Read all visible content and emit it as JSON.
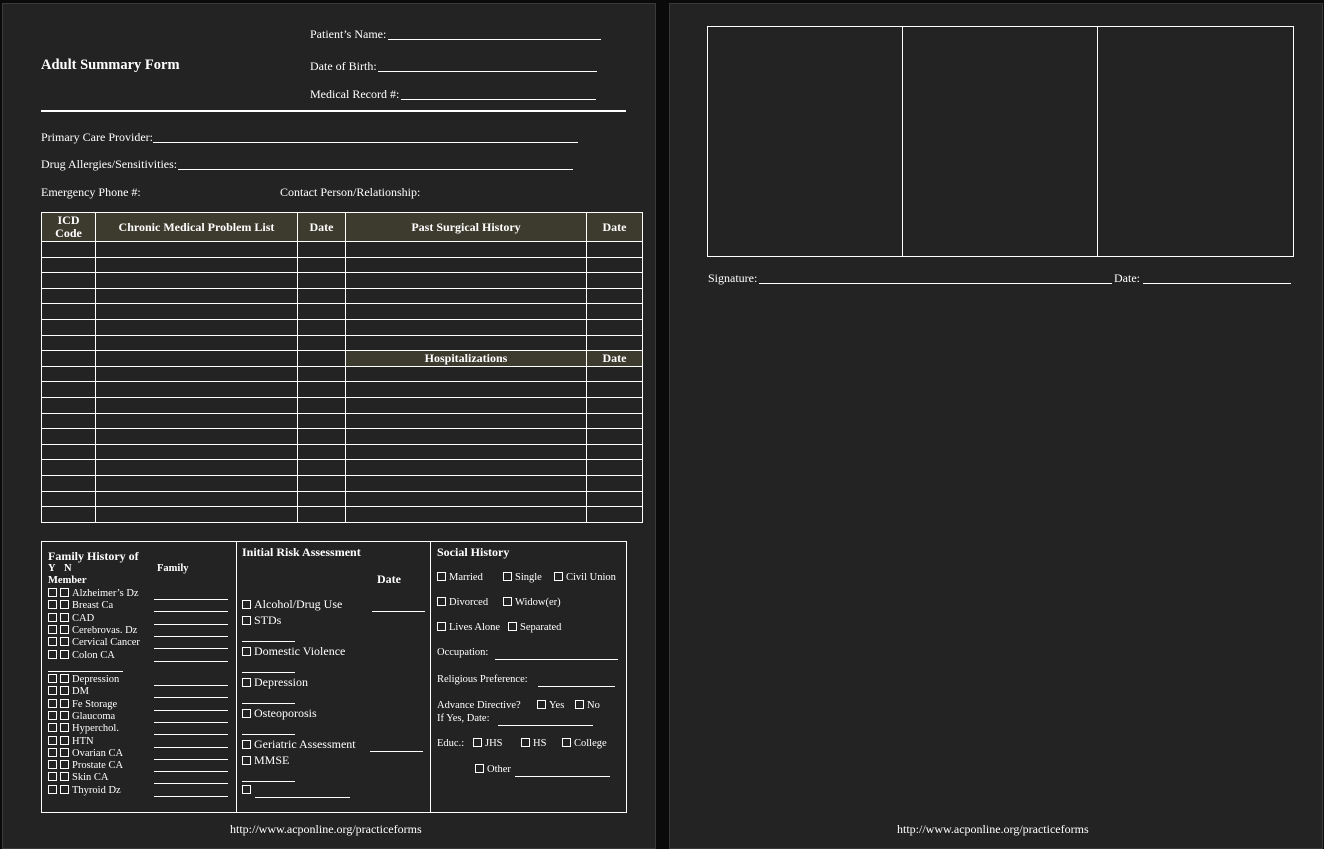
{
  "page1": {
    "title": "Adult Summary Form",
    "patient_name_label": "Patient’s Name:",
    "dob_label": "Date of Birth:",
    "mrn_label": "Medical Record #:",
    "pcp_label": "Primary Care Provider:",
    "allergies_label": "Drug Allergies/Sensitivities:",
    "emergency_label": "Emergency Phone #:",
    "contact_label": "Contact Person/Relationship:",
    "table": {
      "headers": [
        "ICD Code",
        "Chronic Medical Problem List",
        "Date",
        "Past Surgical History",
        "Date"
      ],
      "hospitalizations_header": "Hospitalizations",
      "hospitalizations_date": "Date"
    },
    "family_history": {
      "title": "Family History of",
      "y": "Y",
      "n": "N",
      "member": "Member",
      "family": "Family",
      "items_a": [
        "Alzheimer’s Dz",
        "Breast Ca",
        "CAD",
        "Cerebrovas. Dz",
        "Cervical Cancer",
        "Colon CA"
      ],
      "items_b": [
        "Depression",
        "DM",
        "Fe Storage",
        "Glaucoma",
        "Hyperchol.",
        "HTN",
        "Ovarian CA",
        "Prostate CA",
        "Skin CA",
        "Thyroid Dz"
      ]
    },
    "risk": {
      "title": "Initial Risk Assessment",
      "date": "Date",
      "items": [
        "Alcohol/Drug Use",
        "STDs",
        "Domestic Violence",
        "Depression",
        "Osteoporosis",
        "Geriatric Assessment",
        "MMSE"
      ]
    },
    "social": {
      "title": "Social History",
      "married": "Married",
      "single": "Single",
      "civil_union": "Civil Union",
      "divorced": "Divorced",
      "widow": "Widow(er)",
      "lives_alone": "Lives Alone",
      "separated": "Separated",
      "occupation": "Occupation:",
      "religious": "Religious Preference:",
      "advance": "Advance Directive?",
      "yes": "Yes",
      "no": "No",
      "if_yes": "If Yes, Date:",
      "educ": "Educ.:",
      "jhs": "JHS",
      "hs": "HS",
      "college": "College",
      "other": "Other"
    },
    "footer": "http://www.acponline.org/practiceforms"
  },
  "page2": {
    "signature_label": "Signature:",
    "date_label": "Date:",
    "footer": "http://www.acponline.org/practiceforms"
  }
}
